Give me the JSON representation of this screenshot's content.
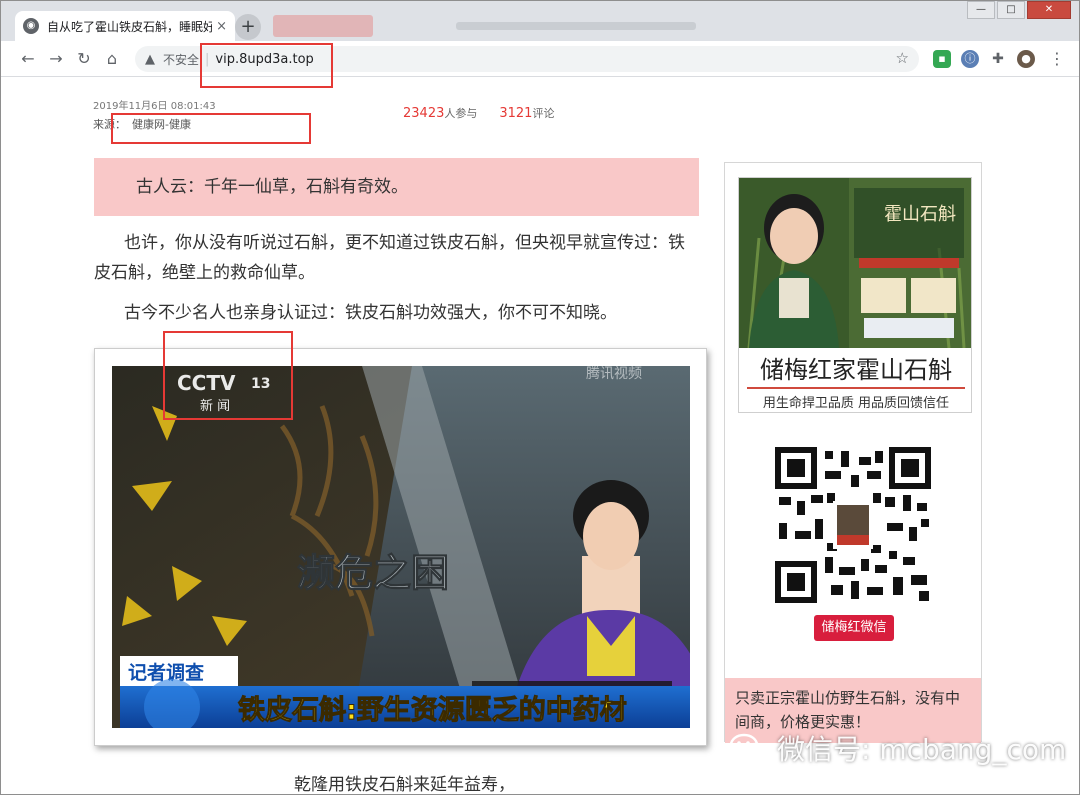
{
  "browser": {
    "tab_title": "自从吃了霍山铁皮石斛，睡眠好了",
    "tab_close": "×",
    "new_tab": "+",
    "insecure_label": "不安全",
    "url": "vip.8upd3a.top",
    "win_minimize": "—",
    "win_maximize": "□",
    "win_close": "✕"
  },
  "article": {
    "date": "2019年11月6日  08:01:43",
    "source_label": "来源：",
    "source_value": "健康网-健康",
    "participants_count": "23423",
    "participants_label": "人参与",
    "comments_count": "3121",
    "comments_label": "评论",
    "quote": "古人云：千年一仙草，石斛有奇效。",
    "para1": "也许，你从没有听说过石斛，更不知道过铁皮石斛，但央视早就宣传过：铁皮石斛，绝壁上的救命仙草。",
    "para2": "古今不少名人也亲身认证过：铁皮石斛功效强大，你不可不知晓。",
    "tail": "乾隆用铁皮石斛来延年益寿，"
  },
  "video": {
    "channel_logo": "CCTV",
    "channel_number": "13",
    "channel_name": "新  闻",
    "corner_logo": "腾讯视频",
    "overlay_title": "濒危之困",
    "segment_tag": "记者调查",
    "headline": "铁皮石斛:野生资源匮乏的中药材"
  },
  "sidebar": {
    "ad_badge": "霍山石斛",
    "ad_name": "储梅红家霍山石斛",
    "ad_slogan": "用生命捍卫品质  用品质回馈信任",
    "wechat_button": "储梅红微信",
    "note": "只卖正宗霍山仿野生石斛，没有中间商，价格更实惠！"
  },
  "watermark": "微信号: mcbang_com",
  "colors": {
    "accent_red": "#e53935",
    "highlight_pink": "#f9c8c8",
    "wechat_button": "#d81e3d"
  }
}
